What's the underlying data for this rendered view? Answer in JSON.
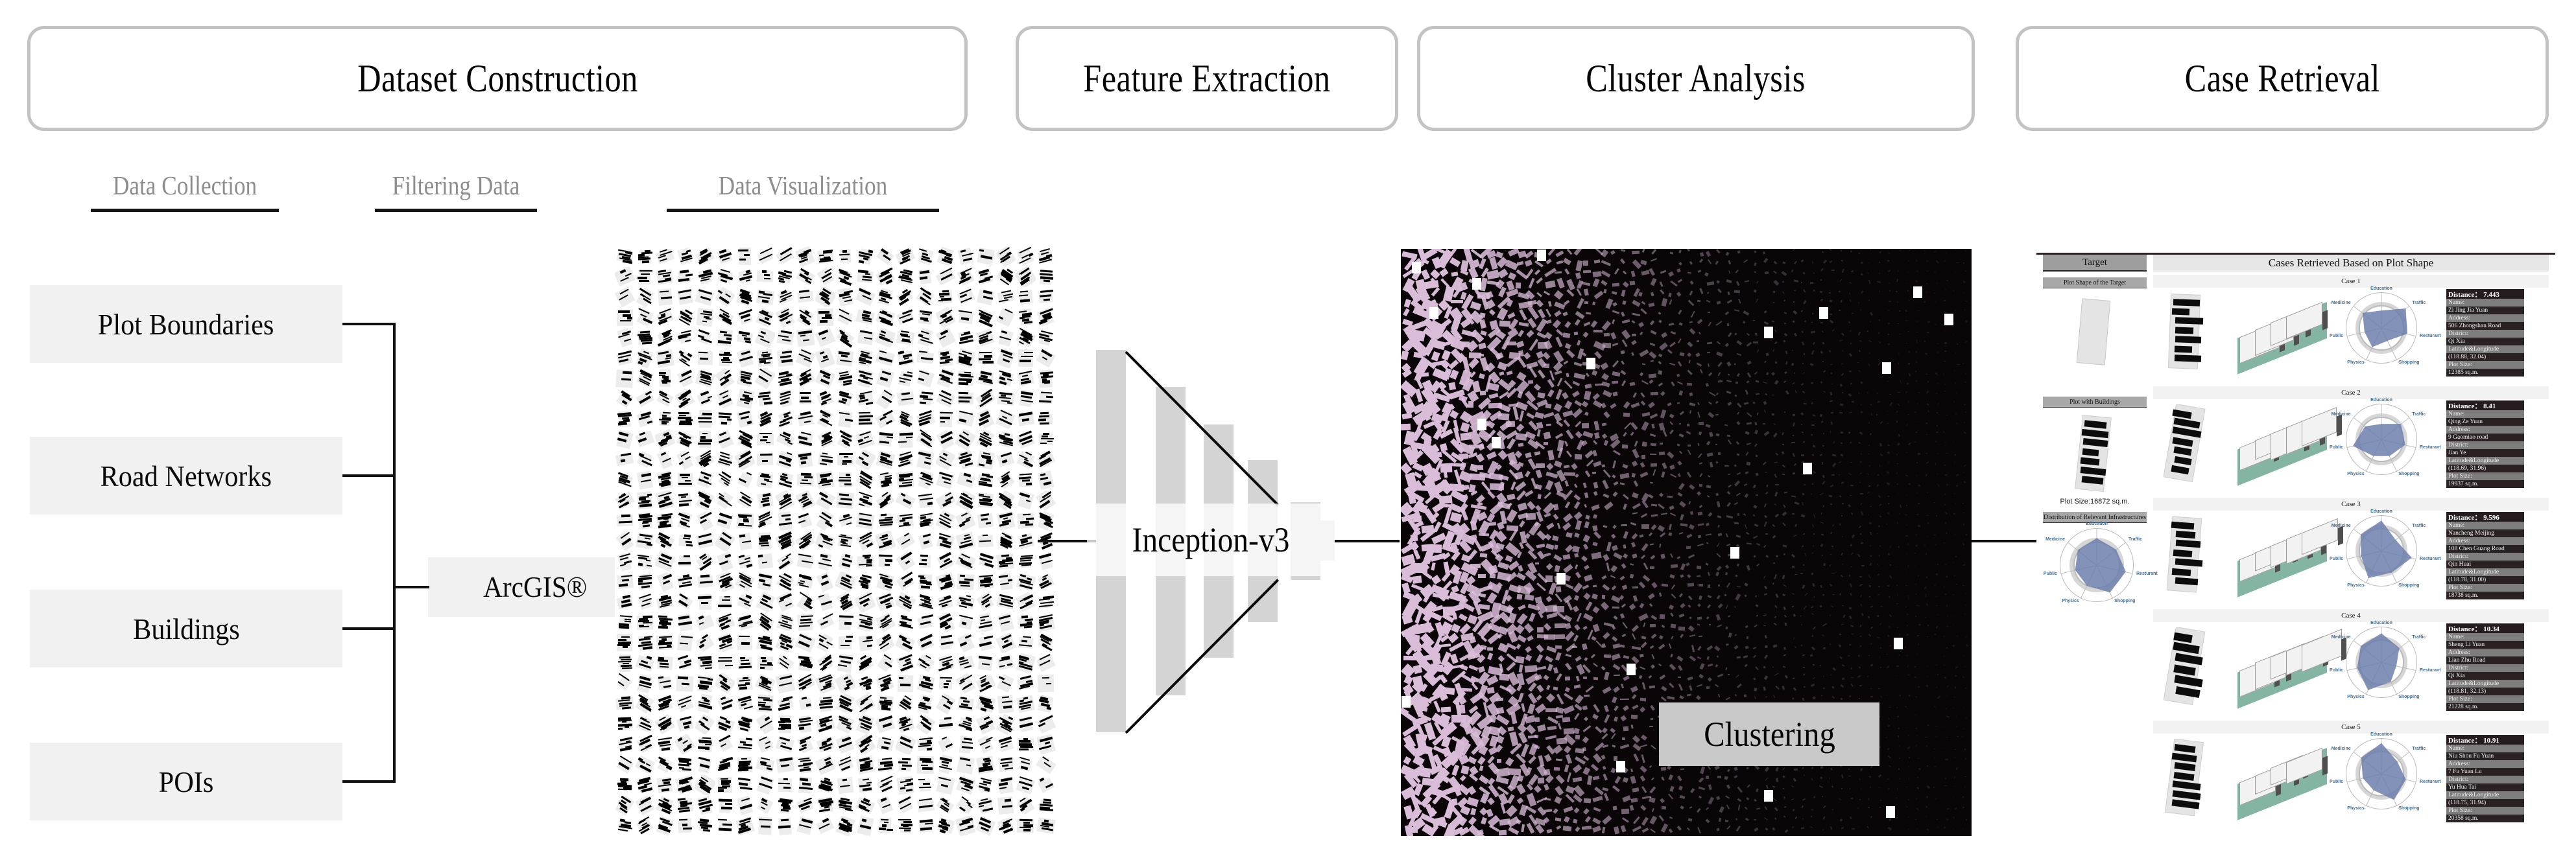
{
  "phases": [
    {
      "id": "dataset-construction",
      "label": "Dataset Construction"
    },
    {
      "id": "feature-extraction",
      "label": "Feature Extraction"
    },
    {
      "id": "cluster-analysis",
      "label": "Cluster Analysis"
    },
    {
      "id": "case-retrieval",
      "label": "Case Retrieval"
    }
  ],
  "substeps": [
    {
      "id": "data-collection",
      "label": "Data Collection"
    },
    {
      "id": "filtering-data",
      "label": "Filtering Data"
    },
    {
      "id": "data-visualization",
      "label": "Data Visualization"
    }
  ],
  "sources": [
    {
      "id": "plot-boundaries",
      "label": "Plot Boundaries"
    },
    {
      "id": "road-networks",
      "label": "Road Networks"
    },
    {
      "id": "buildings",
      "label": "Buildings"
    },
    {
      "id": "pois",
      "label": "POIs"
    }
  ],
  "gis_tool": {
    "label": "ArcGIS®"
  },
  "model": {
    "label": "Inception-v3"
  },
  "cluster": {
    "badge": "Clustering"
  },
  "retrieval": {
    "target_header": "Target",
    "cases_header": "Cases Retrieved Based on Plot Shape",
    "target_shape_label": "Plot Shape of the Target",
    "target_buildings_label": "Plot with Buildings",
    "target_plot_size": "Plot Size:16872 sq.m.",
    "target_infra_label": "Distribution of Relevant Infrastructures",
    "radar_axes": [
      "Education",
      "Traffic",
      "Resturant",
      "Shopping",
      "Physics",
      "Public",
      "Medicine"
    ],
    "field_labels": {
      "distance": "Distance：",
      "name": "Name:",
      "address": "Address:",
      "district": "District:",
      "latlon": "Latitude&Longitude",
      "plot_size": "Plot Size:"
    },
    "cases": [
      {
        "title": "Case 1",
        "distance": "7.443",
        "name": "Zi Jing Jia Yuan",
        "address": "506 Zhongshan Road",
        "district": "Qi Xia",
        "latlon": "(118.88, 32.04)",
        "plot_size": "12385 sq.m."
      },
      {
        "title": "Case 2",
        "distance": "8.41",
        "name": "Qing Ze Yuan",
        "address": "9 Gaomiao road",
        "district": "Jian Ye",
        "latlon": "(118.69, 31.96)",
        "plot_size": "19937 sq.m."
      },
      {
        "title": "Case 3",
        "distance": "9.596",
        "name": "Nancheng Meijing",
        "address": "108 Chen Guang Road",
        "district": "Qin Huai",
        "latlon": "(118.78, 31.00)",
        "plot_size": "18738 sq.m."
      },
      {
        "title": "Case 4",
        "distance": "10.34",
        "name": "Sheng Li Yuan",
        "address": "Lian Zhu Road",
        "district": "Qi Xia",
        "latlon": "(118.81, 32.13)",
        "plot_size": "21228 sq.m."
      },
      {
        "title": "Case 5",
        "distance": "10.91",
        "name": "Niu Shou Fu Yuan",
        "address": "7 Fu Yuan Lu",
        "district": "Yu Hua Tai",
        "latlon": "(118.75, 31.94)",
        "plot_size": "20358 sq.m."
      }
    ]
  },
  "colors": {
    "phase_border": "#c3c3c3",
    "chip_bg": "#f1f1f1",
    "substep_text": "#8d8d8d",
    "funnel_bar": "#d4d4d4",
    "cluster_bg": "#0a0608",
    "cluster_point": "#d9bcd8",
    "badge_bg": "#c9c9c9",
    "radar_fill": "#6c7fab",
    "massing_base": "#84b5a2",
    "info_bg": "#2a2123",
    "info_key": "#7d7d7d"
  }
}
